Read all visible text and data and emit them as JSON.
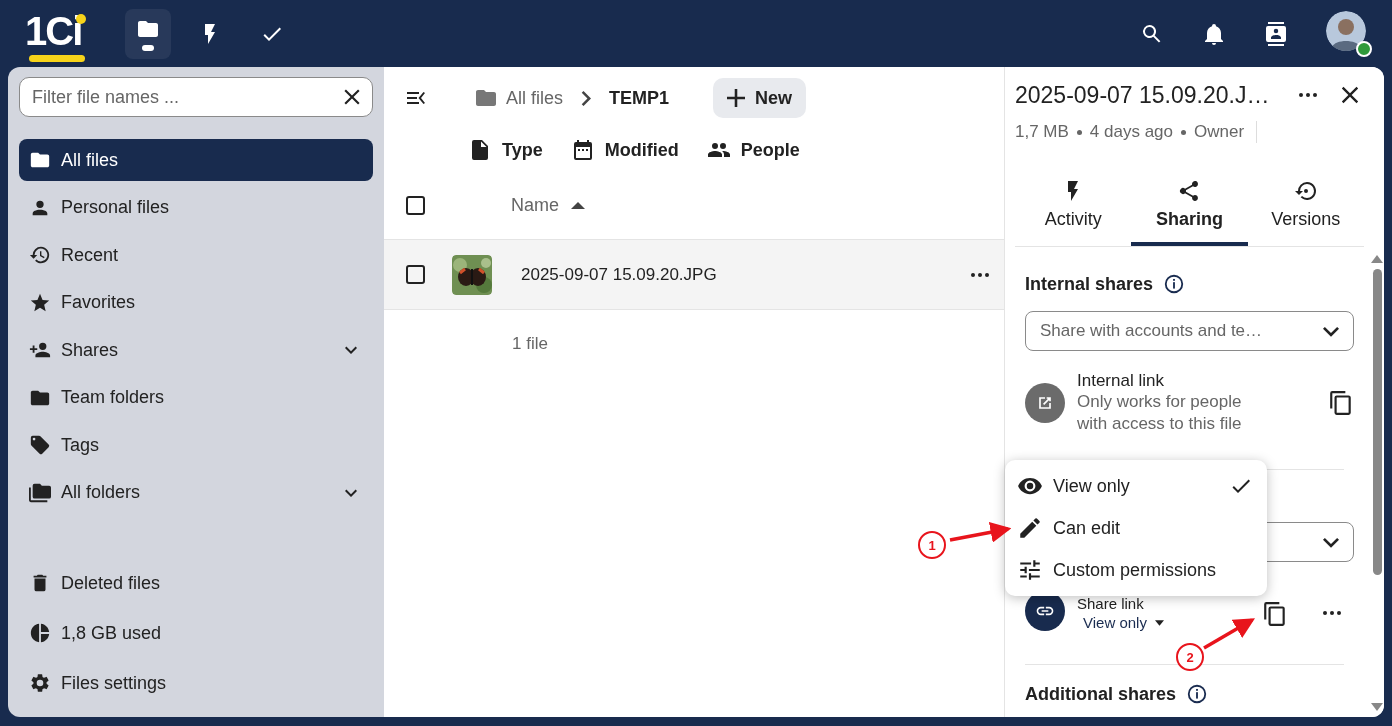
{
  "topbar": {
    "logo": "1Ci",
    "apps": [
      {
        "kind": "files",
        "selected": true
      },
      {
        "kind": "activity",
        "selected": false
      },
      {
        "kind": "tasks",
        "selected": false
      }
    ],
    "actions": [
      {
        "kind": "search"
      },
      {
        "kind": "notifications"
      },
      {
        "kind": "contacts"
      }
    ],
    "avatar": {
      "online": true
    }
  },
  "filter": {
    "placeholder": "Filter file names ..."
  },
  "navigation": [
    {
      "kind": "folder",
      "label": "All files",
      "selected": true,
      "expandable": false
    },
    {
      "kind": "person",
      "label": "Personal files",
      "selected": false,
      "expandable": false
    },
    {
      "kind": "history",
      "label": "Recent",
      "selected": false,
      "expandable": false
    },
    {
      "kind": "star",
      "label": "Favorites",
      "selected": false,
      "expandable": false
    },
    {
      "kind": "share",
      "label": "Shares",
      "selected": false,
      "expandable": true
    },
    {
      "kind": "team",
      "label": "Team folders",
      "selected": false,
      "expandable": false
    },
    {
      "kind": "tag",
      "label": "Tags",
      "selected": false,
      "expandable": false
    },
    {
      "kind": "folders",
      "label": "All folders",
      "selected": false,
      "expandable": true
    }
  ],
  "footer_items": [
    {
      "kind": "trash",
      "label": "Deleted files"
    },
    {
      "kind": "pie",
      "label": "1,8 GB used"
    },
    {
      "kind": "cog",
      "label": "Files settings"
    }
  ],
  "breadcrumb": [
    {
      "label": "All files",
      "current": false
    },
    {
      "label": "TEMP1",
      "current": true
    }
  ],
  "new_button": "New",
  "filters": [
    {
      "kind": "file",
      "label": "Type"
    },
    {
      "kind": "calendar",
      "label": "Modified"
    },
    {
      "kind": "people",
      "label": "People"
    }
  ],
  "table": {
    "all_selected": false,
    "columns": [
      {
        "label": "Name",
        "sorted_ascending": true
      }
    ],
    "rows": [
      {
        "name": "2025-09-07 15.09.20.JPG",
        "selected": false,
        "kind": "picture"
      }
    ],
    "summary": "1 file"
  },
  "details": {
    "title": "2025-09-07 15.09.20.J…",
    "meta": [
      "1,7 MB",
      "4 days ago",
      "Owner"
    ],
    "tabs": [
      {
        "kind": "activity",
        "label": "Activity",
        "selected": false
      },
      {
        "kind": "share",
        "label": "Sharing",
        "selected": true
      },
      {
        "kind": "versions",
        "label": "Versions",
        "selected": false
      }
    ],
    "internal_heading": "Internal shares",
    "share_placeholder": "Share with accounts and te…",
    "internal_link": {
      "title": "Internal link",
      "description": "Only works for people with access to this file"
    },
    "share_link": {
      "title": "Share link",
      "permission": "View only"
    },
    "additional_heading": "Additional shares"
  },
  "permission_menu": [
    {
      "kind": "view",
      "label": "View only",
      "selected": true
    },
    {
      "kind": "edit",
      "label": "Can edit",
      "selected": false
    },
    {
      "kind": "custom",
      "label": "Custom permissions",
      "selected": false
    }
  ],
  "annotations": [
    {
      "label": "1"
    },
    {
      "label": "2"
    }
  ]
}
